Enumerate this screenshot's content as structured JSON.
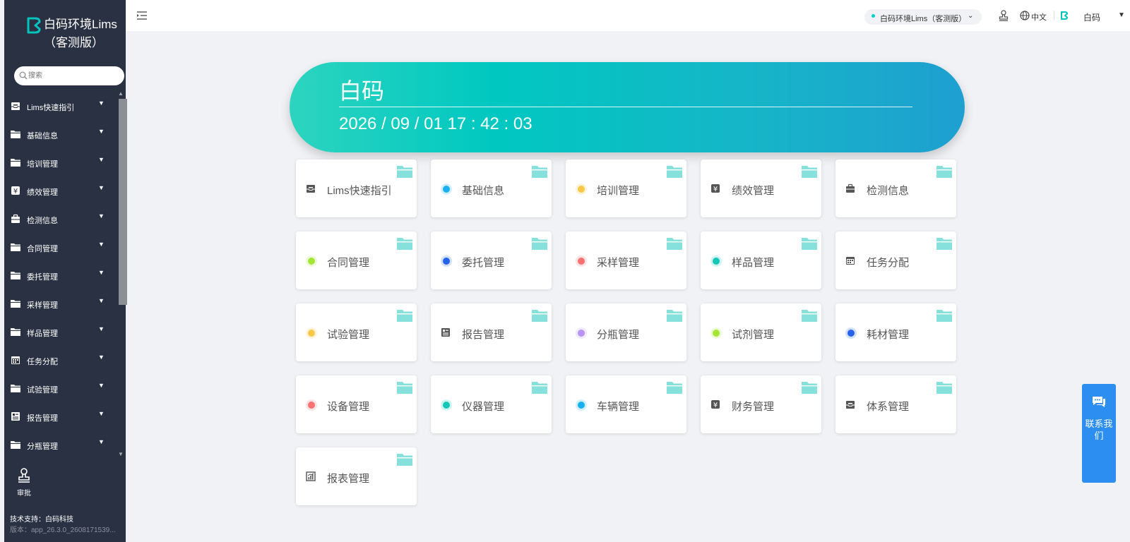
{
  "app": {
    "title": "白码环境Lims（客测版）",
    "brand_color": "#00c4bd"
  },
  "sidebar": {
    "search_placeholder": "搜索",
    "items": [
      {
        "label": "Lims快速指引",
        "icon": "inbox-icon"
      },
      {
        "label": "基础信息",
        "icon": "folder-icon"
      },
      {
        "label": "培训管理",
        "icon": "folder-icon"
      },
      {
        "label": "绩效管理",
        "icon": "yen-icon"
      },
      {
        "label": "检测信息",
        "icon": "briefcase-icon"
      },
      {
        "label": "合同管理",
        "icon": "folder-icon"
      },
      {
        "label": "委托管理",
        "icon": "folder-icon"
      },
      {
        "label": "采样管理",
        "icon": "folder-icon"
      },
      {
        "label": "样品管理",
        "icon": "folder-icon"
      },
      {
        "label": "任务分配",
        "icon": "calendar-icon"
      },
      {
        "label": "试验管理",
        "icon": "folder-icon"
      },
      {
        "label": "报告管理",
        "icon": "report-icon"
      },
      {
        "label": "分瓶管理",
        "icon": "folder-icon"
      }
    ],
    "approve_label": "审批",
    "support": "技术支持：白码科技",
    "version": "版本：app_26.3.0_2608171539..."
  },
  "header": {
    "environment": "白码环境Lims（客测版）",
    "language": "中文",
    "user_name": "白码"
  },
  "banner": {
    "title": "白码",
    "datetime": "2026 / 09 / 01 17 : 42 : 03"
  },
  "cards": [
    {
      "label": "Lims快速指引",
      "icon": "inbox-icon"
    },
    {
      "label": "基础信息",
      "dot": "#1ab0ef"
    },
    {
      "label": "培训管理",
      "dot": "#f7c948"
    },
    {
      "label": "绩效管理",
      "icon": "yen-icon"
    },
    {
      "label": "检测信息",
      "icon": "briefcase-icon"
    },
    {
      "label": "合同管理",
      "dot": "#a3e635"
    },
    {
      "label": "委托管理",
      "dot": "#2563eb"
    },
    {
      "label": "采样管理",
      "dot": "#f87171"
    },
    {
      "label": "样品管理",
      "dot": "#14c7b8"
    },
    {
      "label": "任务分配",
      "icon": "calendar-icon"
    },
    {
      "label": "试验管理",
      "dot": "#f7c948"
    },
    {
      "label": "报告管理",
      "icon": "report-icon"
    },
    {
      "label": "分瓶管理",
      "dot": "#b794f6"
    },
    {
      "label": "试剂管理",
      "dot": "#a3e635"
    },
    {
      "label": "耗材管理",
      "dot": "#2563eb"
    },
    {
      "label": "设备管理",
      "dot": "#f87171"
    },
    {
      "label": "仪器管理",
      "dot": "#14c7b8"
    },
    {
      "label": "车辆管理",
      "dot": "#1ab0ef"
    },
    {
      "label": "财务管理",
      "icon": "yen-icon"
    },
    {
      "label": "体系管理",
      "icon": "inbox-icon"
    },
    {
      "label": "报表管理",
      "icon": "chart-icon"
    }
  ],
  "contact": {
    "label": "联系我们"
  }
}
